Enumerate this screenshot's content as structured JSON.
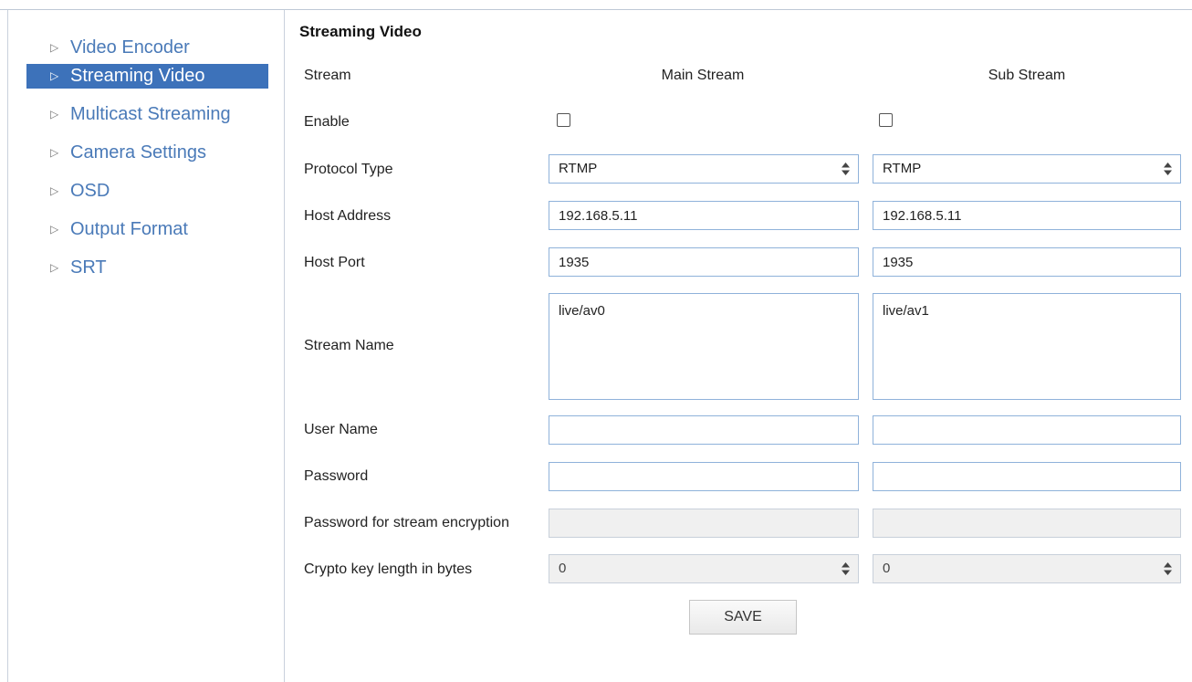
{
  "sidebar": {
    "items": [
      {
        "label": "Video Encoder",
        "active": false
      },
      {
        "label": "Streaming Video",
        "active": true
      },
      {
        "label": "Multicast Streaming",
        "active": false
      },
      {
        "label": "Camera Settings",
        "active": false
      },
      {
        "label": "OSD",
        "active": false
      },
      {
        "label": "Output Format",
        "active": false
      },
      {
        "label": "SRT",
        "active": false
      }
    ]
  },
  "main": {
    "title": "Streaming Video",
    "header": {
      "stream_label": "Stream",
      "main": "Main Stream",
      "sub": "Sub Stream"
    },
    "rows": {
      "enable": "Enable",
      "protocol_type": "Protocol Type",
      "host_address": "Host Address",
      "host_port": "Host Port",
      "stream_name": "Stream Name",
      "user_name": "User Name",
      "password": "Password",
      "password_encryption": "Password for stream encryption",
      "crypto_key_length": "Crypto key length in bytes"
    },
    "main_stream": {
      "enabled": false,
      "protocol": "RTMP",
      "host_address": "192.168.5.11",
      "host_port": "1935",
      "stream_name": "live/av0",
      "user_name": "",
      "password": "",
      "password_encryption": "",
      "crypto_key_length": "0"
    },
    "sub_stream": {
      "enabled": false,
      "protocol": "RTMP",
      "host_address": "192.168.5.11",
      "host_port": "1935",
      "stream_name": "live/av1",
      "user_name": "",
      "password": "",
      "password_encryption": "",
      "crypto_key_length": "0"
    },
    "save_label": "SAVE"
  },
  "colors": {
    "accent": "#3d72ba",
    "nav_text": "#4a7ab8",
    "field_border": "#8fb2da"
  }
}
